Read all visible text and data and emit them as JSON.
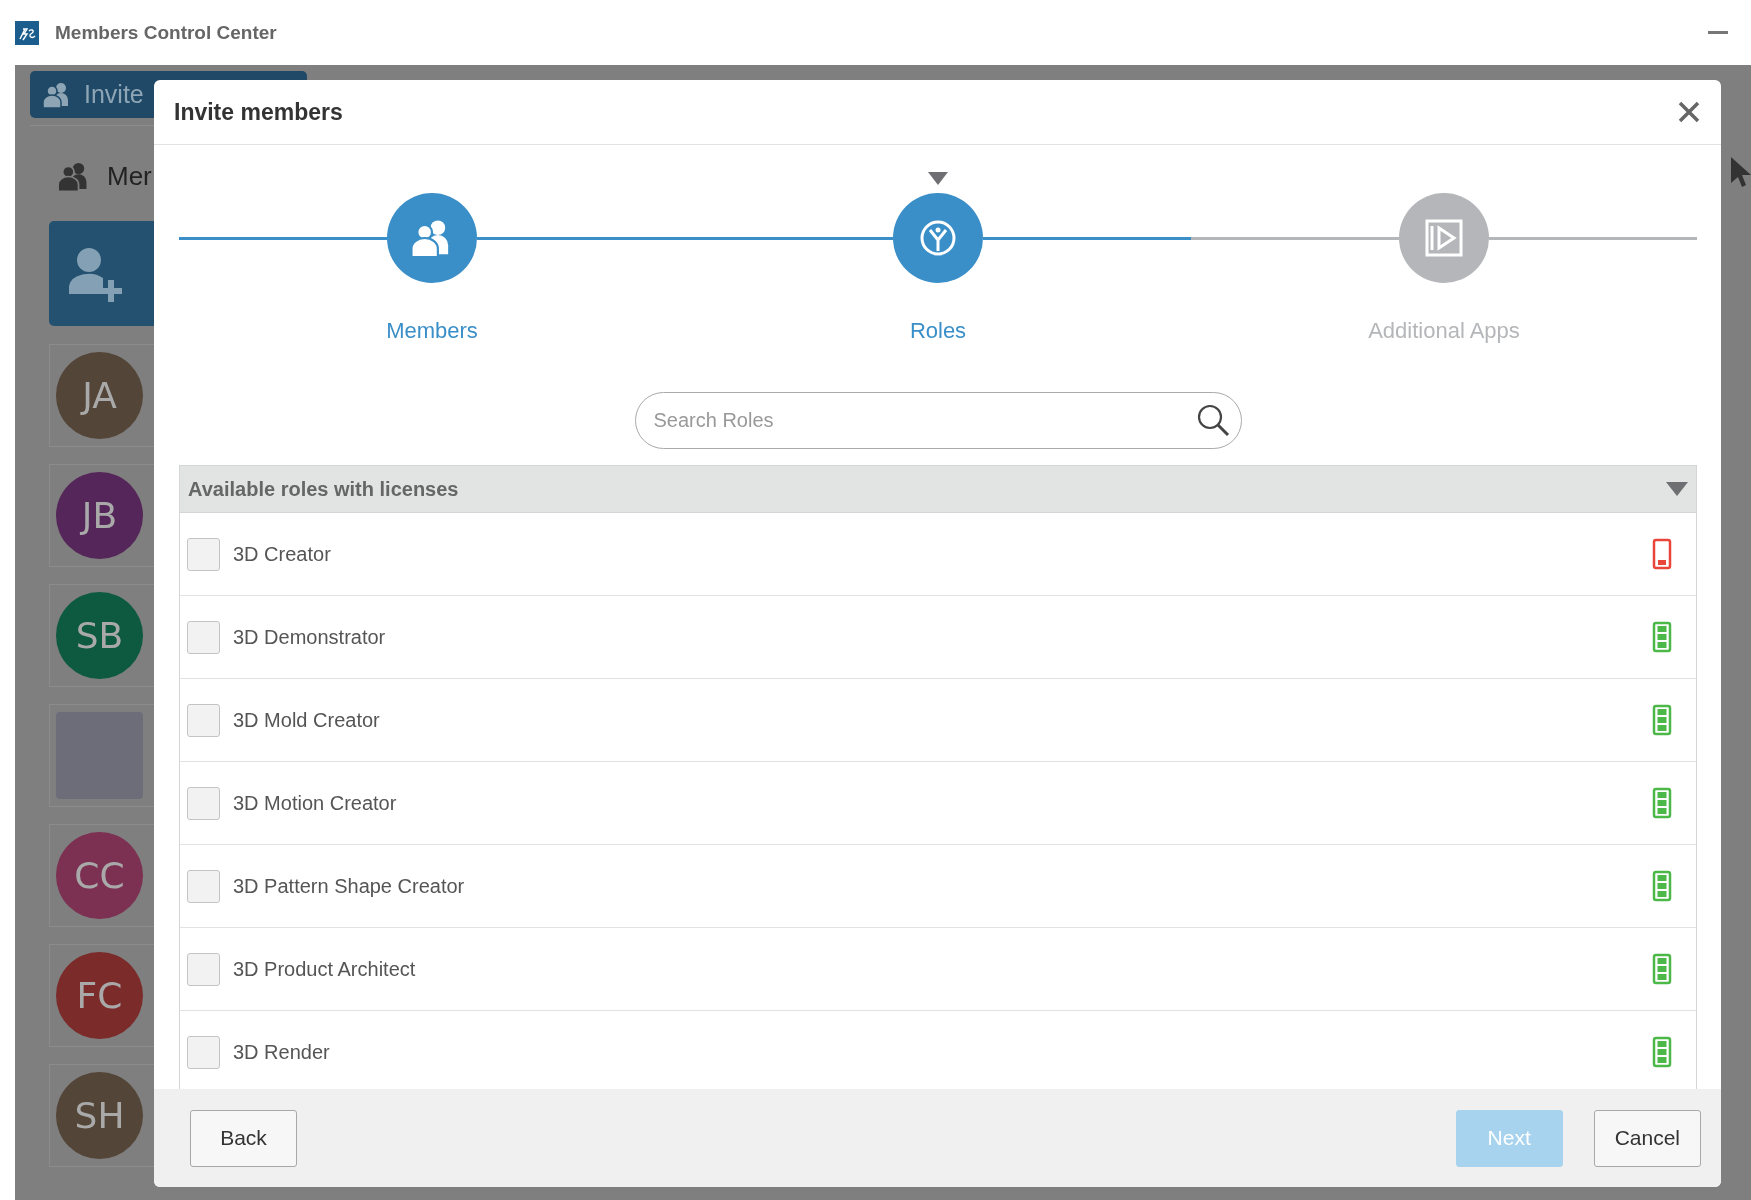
{
  "window": {
    "title": "Members Control Center"
  },
  "background": {
    "invite_button": "Invite",
    "members_heading": "Mer",
    "members": [
      {
        "initials": "JA",
        "kind": "initials",
        "color": "#534537"
      },
      {
        "initials": "JB",
        "kind": "initials",
        "color": "#55265a"
      },
      {
        "initials": "SB",
        "kind": "initials",
        "color": "#0e5a40"
      },
      {
        "kind": "photo"
      },
      {
        "initials": "CC",
        "kind": "initials",
        "color": "#7c3052"
      },
      {
        "initials": "FC",
        "kind": "initials",
        "color": "#7c2b2b"
      },
      {
        "initials": "SH",
        "kind": "initials",
        "color": "#534537"
      }
    ]
  },
  "dialog": {
    "title": "Invite members",
    "steps": [
      {
        "label": "Members",
        "kind": "done"
      },
      {
        "label": "Roles",
        "kind": "current"
      },
      {
        "label": "Additional Apps",
        "kind": "upcoming"
      }
    ],
    "search": {
      "placeholder": "Search Roles"
    },
    "section": {
      "title": "Available roles with licenses",
      "expanded": true,
      "roles": [
        {
          "name": "3D Creator",
          "checked": false,
          "kind": "low"
        },
        {
          "name": "3D Demonstrator",
          "checked": false,
          "kind": "available"
        },
        {
          "name": "3D Mold Creator",
          "checked": false,
          "kind": "available"
        },
        {
          "name": "3D Motion Creator",
          "checked": false,
          "kind": "available"
        },
        {
          "name": "3D Pattern Shape Creator",
          "checked": false,
          "kind": "available"
        },
        {
          "name": "3D Product Architect",
          "checked": false,
          "kind": "available"
        },
        {
          "name": "3D Render",
          "checked": false,
          "kind": "available"
        }
      ]
    },
    "buttons": [
      {
        "label": "Back",
        "disabled": false
      },
      {
        "label": "Next",
        "disabled": true
      },
      {
        "label": "Cancel",
        "disabled": false
      }
    ]
  }
}
